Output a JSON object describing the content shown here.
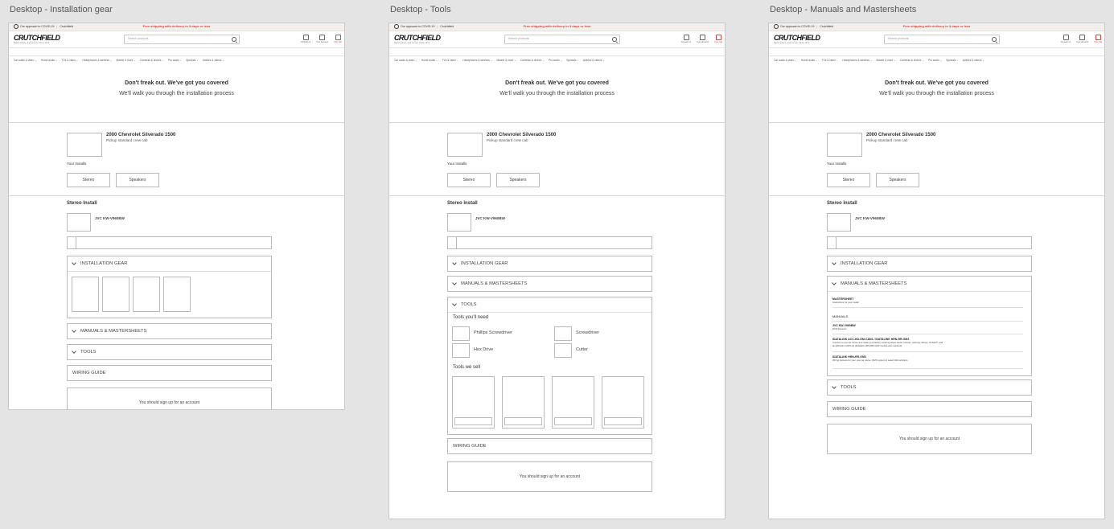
{
  "frames": [
    {
      "title": "Desktop - Installation gear"
    },
    {
      "title": "Desktop - Tools"
    },
    {
      "title": "Desktop - Manuals and Mastersheets"
    }
  ],
  "site": {
    "topbar_left": "Our approach to COVID-19",
    "topbar_mid": "Crutchfield",
    "promo": "Free shipping with delivery in 3 days or less",
    "logo": "CRUTCHFIELD",
    "tagline": "Better advice, and service. Since 1974",
    "search_placeholder": "Search products",
    "header_icons": [
      {
        "label": "Contact us",
        "icon": "chat-icon"
      },
      {
        "label": "Your account",
        "icon": "account-icon"
      },
      {
        "label": "Your cart",
        "icon": "cart-icon"
      }
    ],
    "nav": [
      "Car audio & video ⌄",
      "Home audio ⌄",
      "TVs & video ⌄",
      "Headphones & wireless ⌄",
      "Marine & more ⌄",
      "Cameras & drones ⌄",
      "Pro audio ⌄",
      "Specials ⌄",
      "Articles & videos ⌄"
    ]
  },
  "hero": {
    "line1": "Don't freak out. We've got you covered",
    "line2": "We'll walk you through the installation process"
  },
  "vehicle": {
    "name": "2000 Chevrolet Silverado 1500",
    "sub": "Pickup standard crew cab",
    "your_installs": "Your Installs",
    "buttons": [
      "Stereo",
      "Speakers"
    ]
  },
  "install": {
    "section_label": "Stereo Install",
    "product": "JVC KW-V960BW"
  },
  "accordions": {
    "gear": "INSTALLATION GEAR",
    "manuals": "MANUALS & MASTERSHEETS",
    "tools": "TOOLS",
    "wiring": "WIRING GUIDE"
  },
  "signup": "You should sign up for an account",
  "tools": {
    "need_heading": "Tools you'll need",
    "need_items": [
      "Phillips Screwdriver",
      "Screwdriver",
      "Hex Drive",
      "Cutter"
    ],
    "sold_heading": "Tools we sell"
  },
  "manuals": {
    "mastersheet_title": "MASTERSHEET",
    "mastersheet_desc": "Instructions for your install",
    "manuals_label": "MANUALS",
    "items": [
      {
        "title": "JVC KW-V960BW",
        "desc": "DVD Receiver"
      },
      {
        "title": "IDATALINK ACC-HD-GM-CAN1 / IDATALINK HRN-RR-GM3",
        "desc": "Connect a new car stereo and retain your factory steering wheel audio controls, warning chimes, OnStar®, and amplification (ADS-Ip) (iDatalink HRN-RR-GM3 module also required)"
      },
      {
        "title": "IDATALINK HRN-RR-GM3",
        "desc": "Wiring harness for your new car stereo (DVD system in select GM vehicles)"
      }
    ]
  }
}
